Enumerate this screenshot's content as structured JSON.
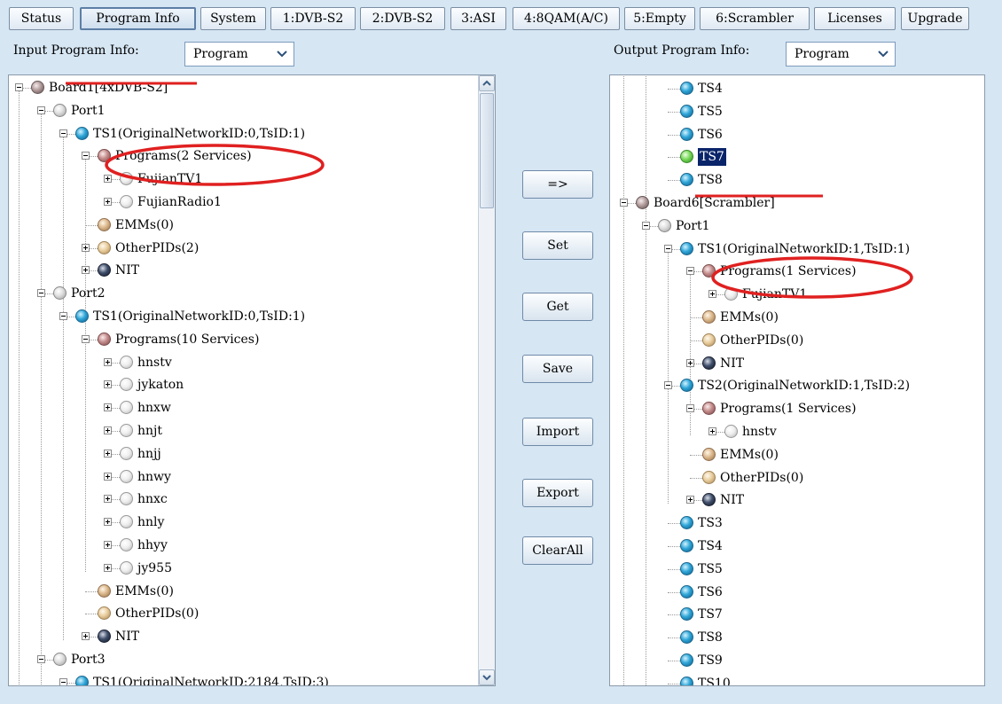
{
  "tabs": [
    {
      "label": "Status",
      "active": false
    },
    {
      "label": "Program Info",
      "active": true
    },
    {
      "label": "System",
      "active": false
    },
    {
      "label": "1:DVB-S2",
      "active": false
    },
    {
      "label": "2:DVB-S2",
      "active": false
    },
    {
      "label": "3:ASI",
      "active": false
    },
    {
      "label": "4:8QAM(A/C)",
      "active": false
    },
    {
      "label": "5:Empty",
      "active": false
    },
    {
      "label": "6:Scrambler",
      "active": false
    },
    {
      "label": "Licenses",
      "active": false
    },
    {
      "label": "Upgrade",
      "active": false
    }
  ],
  "input": {
    "label": "Input Program Info:",
    "select_value": "Program"
  },
  "output": {
    "label": "Output Program Info:",
    "select_value": "Program"
  },
  "buttons": [
    "=>",
    "Set",
    "Get",
    "Save",
    "Import",
    "Export",
    "ClearAll"
  ],
  "left_tree": [
    {
      "level": 0,
      "exp": "minus",
      "icon": "board",
      "text": "Board1[4xDVB-S2]"
    },
    {
      "level": 1,
      "exp": "minus",
      "icon": "port",
      "text": "Port1"
    },
    {
      "level": 2,
      "exp": "minus",
      "icon": "ts",
      "text": "TS1(OriginalNetworkID:0,TsID:1)"
    },
    {
      "level": 3,
      "exp": "minus",
      "icon": "progs",
      "text": "Programs(2 Services)"
    },
    {
      "level": 4,
      "exp": "plus",
      "icon": "svc",
      "text": "FujianTV1"
    },
    {
      "level": 4,
      "exp": "plus",
      "icon": "svc",
      "text": "FujianRadio1"
    },
    {
      "level": 3,
      "exp": "none",
      "icon": "emm",
      "text": "EMMs(0)"
    },
    {
      "level": 3,
      "exp": "plus",
      "icon": "other",
      "text": "OtherPIDs(2)"
    },
    {
      "level": 3,
      "exp": "plus",
      "icon": "nit",
      "text": "NIT"
    },
    {
      "level": 1,
      "exp": "minus",
      "icon": "port",
      "text": "Port2"
    },
    {
      "level": 2,
      "exp": "minus",
      "icon": "ts",
      "text": "TS1(OriginalNetworkID:0,TsID:1)"
    },
    {
      "level": 3,
      "exp": "minus",
      "icon": "progs",
      "text": "Programs(10 Services)"
    },
    {
      "level": 4,
      "exp": "plus",
      "icon": "svc",
      "text": "hnstv"
    },
    {
      "level": 4,
      "exp": "plus",
      "icon": "svc",
      "text": "jykaton"
    },
    {
      "level": 4,
      "exp": "plus",
      "icon": "svc",
      "text": "hnxw"
    },
    {
      "level": 4,
      "exp": "plus",
      "icon": "svc",
      "text": "hnjt"
    },
    {
      "level": 4,
      "exp": "plus",
      "icon": "svc",
      "text": "hnjj"
    },
    {
      "level": 4,
      "exp": "plus",
      "icon": "svc",
      "text": "hnwy"
    },
    {
      "level": 4,
      "exp": "plus",
      "icon": "svc",
      "text": "hnxc"
    },
    {
      "level": 4,
      "exp": "plus",
      "icon": "svc",
      "text": "hnly"
    },
    {
      "level": 4,
      "exp": "plus",
      "icon": "svc",
      "text": "hhyy"
    },
    {
      "level": 4,
      "exp": "plus",
      "icon": "svc",
      "text": "jy955"
    },
    {
      "level": 3,
      "exp": "none",
      "icon": "emm",
      "text": "EMMs(0)"
    },
    {
      "level": 3,
      "exp": "none",
      "icon": "other",
      "text": "OtherPIDs(0)"
    },
    {
      "level": 3,
      "exp": "plus",
      "icon": "nit",
      "text": "NIT"
    },
    {
      "level": 1,
      "exp": "minus",
      "icon": "port",
      "text": "Port3"
    },
    {
      "level": 2,
      "exp": "minus",
      "icon": "ts",
      "text": "TS1(OriginalNetworkID:2184,TsID:3)"
    }
  ],
  "right_tree": [
    {
      "level": 2,
      "exp": "none",
      "icon": "ts",
      "text": "TS4"
    },
    {
      "level": 2,
      "exp": "none",
      "icon": "ts",
      "text": "TS5"
    },
    {
      "level": 2,
      "exp": "none",
      "icon": "ts",
      "text": "TS6"
    },
    {
      "level": 2,
      "exp": "none",
      "icon": "green",
      "text": "TS7",
      "selected": true
    },
    {
      "level": 2,
      "exp": "none",
      "icon": "ts",
      "text": "TS8"
    },
    {
      "level": 0,
      "exp": "minus",
      "icon": "board",
      "text": "Board6[Scrambler]"
    },
    {
      "level": 1,
      "exp": "minus",
      "icon": "port",
      "text": "Port1"
    },
    {
      "level": 2,
      "exp": "minus",
      "icon": "ts",
      "text": "TS1(OriginalNetworkID:1,TsID:1)"
    },
    {
      "level": 3,
      "exp": "minus",
      "icon": "progs",
      "text": "Programs(1 Services)"
    },
    {
      "level": 4,
      "exp": "plus",
      "icon": "svc",
      "text": "FujianTV1"
    },
    {
      "level": 3,
      "exp": "none",
      "icon": "emm",
      "text": "EMMs(0)"
    },
    {
      "level": 3,
      "exp": "none",
      "icon": "other",
      "text": "OtherPIDs(0)"
    },
    {
      "level": 3,
      "exp": "plus",
      "icon": "nit",
      "text": "NIT"
    },
    {
      "level": 2,
      "exp": "minus",
      "icon": "ts",
      "text": "TS2(OriginalNetworkID:1,TsID:2)"
    },
    {
      "level": 3,
      "exp": "minus",
      "icon": "progs",
      "text": "Programs(1 Services)"
    },
    {
      "level": 4,
      "exp": "plus",
      "icon": "svc",
      "text": "hnstv"
    },
    {
      "level": 3,
      "exp": "none",
      "icon": "emm",
      "text": "EMMs(0)"
    },
    {
      "level": 3,
      "exp": "none",
      "icon": "other",
      "text": "OtherPIDs(0)"
    },
    {
      "level": 3,
      "exp": "plus",
      "icon": "nit",
      "text": "NIT"
    },
    {
      "level": 2,
      "exp": "none",
      "icon": "ts",
      "text": "TS3"
    },
    {
      "level": 2,
      "exp": "none",
      "icon": "ts",
      "text": "TS4"
    },
    {
      "level": 2,
      "exp": "none",
      "icon": "ts",
      "text": "TS5"
    },
    {
      "level": 2,
      "exp": "none",
      "icon": "ts",
      "text": "TS6"
    },
    {
      "level": 2,
      "exp": "none",
      "icon": "ts",
      "text": "TS7"
    },
    {
      "level": 2,
      "exp": "none",
      "icon": "ts",
      "text": "TS8"
    },
    {
      "level": 2,
      "exp": "none",
      "icon": "ts",
      "text": "TS9"
    },
    {
      "level": 2,
      "exp": "none",
      "icon": "ts",
      "text": "TS10"
    }
  ],
  "colors": {
    "annotation": "#e02020",
    "selection": "#0a246a",
    "background": "#d6e6f3"
  },
  "icons": {
    "board": "board-icon",
    "port": "port-icon",
    "ts": "ts-icon",
    "progs": "programs-icon",
    "svc": "service-icon",
    "emm": "emm-icon",
    "other": "otherpids-icon",
    "nit": "nit-icon",
    "green": "ts-selected-icon"
  }
}
